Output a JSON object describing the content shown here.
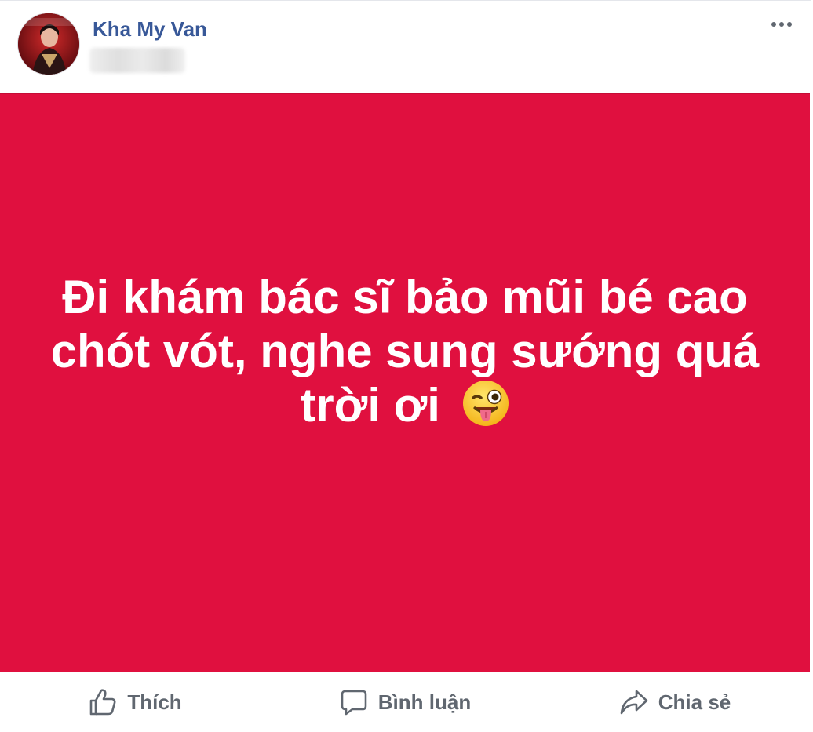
{
  "post": {
    "author": "Kha My Van",
    "banner_text": "Đi khám bác sĩ bảo mũi bé cao chót vót, nghe sung sướng quá trời ơi",
    "banner_color": "#e0103f",
    "emoji": "winking-face-with-tongue"
  },
  "actions": {
    "like": "Thích",
    "comment": "Bình luận",
    "share": "Chia sẻ"
  },
  "colors": {
    "author_link": "#385898",
    "action_text": "#606770"
  },
  "icons": {
    "more": "ellipsis-icon",
    "like": "thumbs-up-icon",
    "comment": "comment-bubble-icon",
    "share": "share-arrow-icon"
  }
}
